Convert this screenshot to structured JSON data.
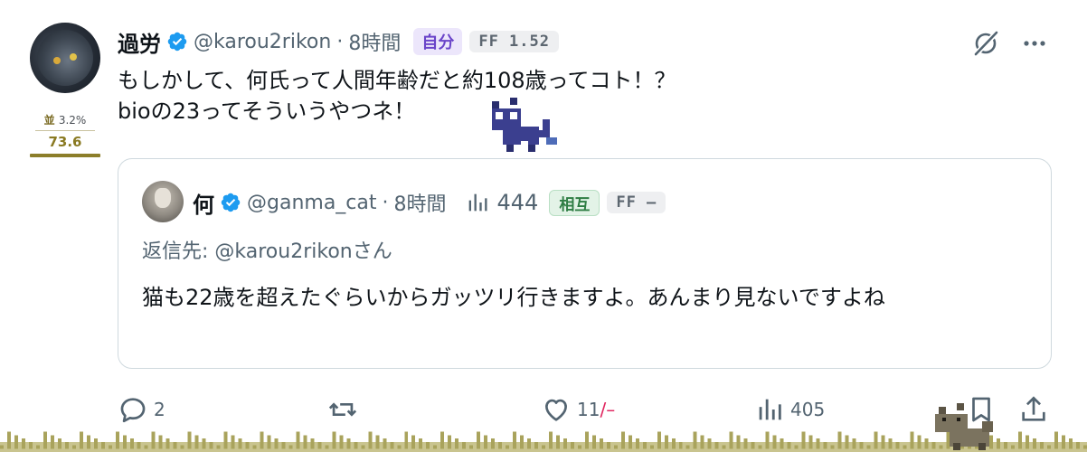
{
  "tweet": {
    "author_name": "過労",
    "handle": "@karou2rikon",
    "separator": "·",
    "time": "8時間",
    "relation_badge": "自分",
    "ff_badge": "FF 1.52",
    "text_line1": "もしかして、何氏って人間年齢だと約108歳ってコト！？",
    "text_line2": "bioの23ってそういうやつネ！"
  },
  "score": {
    "rank": "並",
    "percent": "3.2%",
    "value": "73.6"
  },
  "quote": {
    "author_name": "何",
    "handle": "@ganma_cat",
    "separator": "·",
    "time": "8時間",
    "views": "444",
    "relation_badge": "相互",
    "ff_badge": "FF –",
    "reply_to": "返信先: @karou2rikonさん",
    "text": "猫も22歳を超えたぐらいからガッツリ行きますよ。あんまり見ないですよね"
  },
  "actions": {
    "reply_count": "2",
    "retweet_count": "",
    "like_count": "11",
    "like_suffix": "/–",
    "view_count": "405"
  },
  "colors": {
    "verified": "#1d9bf0",
    "self_pill": "#6a44c9",
    "mutual_pill": "#2e7d43",
    "like_slash": "#e0245e",
    "secondary_text": "#536471"
  }
}
